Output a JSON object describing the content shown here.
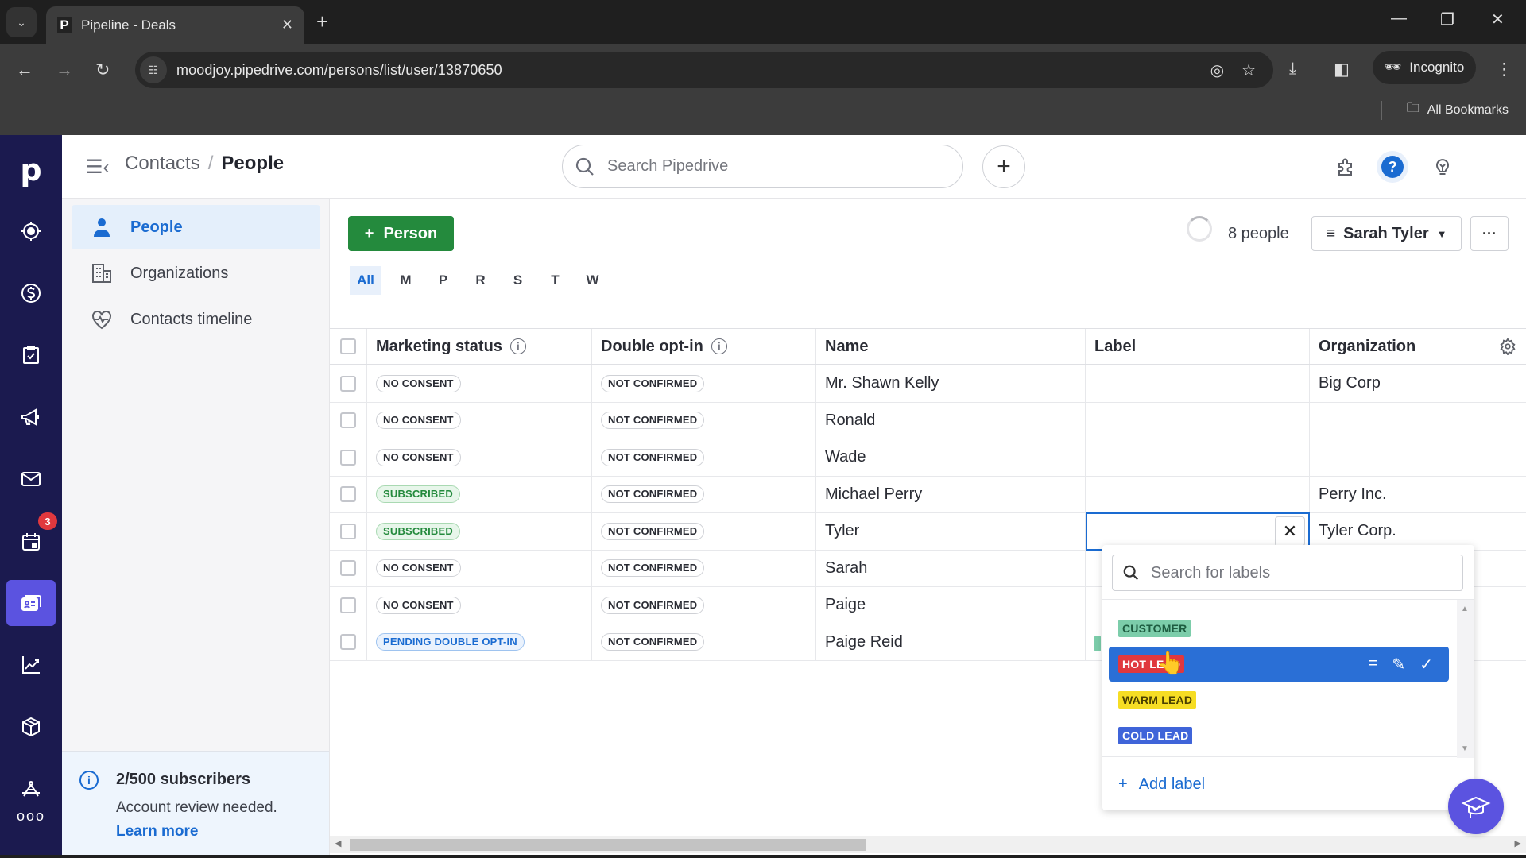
{
  "browser": {
    "tab_title": "Pipeline - Deals",
    "tab_favicon": "P",
    "url": "moodjoy.pipedrive.com/persons/list/user/13870650",
    "incognito_label": "Incognito",
    "bookmarks_label": "All Bookmarks"
  },
  "rail": {
    "logo": "p",
    "items": [
      {
        "icon": "target-icon",
        "label": "Leads"
      },
      {
        "icon": "dollar-icon",
        "label": "Deals"
      },
      {
        "icon": "clipboard-check-icon",
        "label": "Projects"
      },
      {
        "icon": "megaphone-icon",
        "label": "Campaigns"
      },
      {
        "icon": "mail-icon",
        "label": "Mail"
      },
      {
        "icon": "calendar-icon",
        "label": "Activities",
        "badge": "3"
      },
      {
        "icon": "contacts-card-icon",
        "label": "Contacts",
        "active": true
      },
      {
        "icon": "chart-icon",
        "label": "Insights"
      },
      {
        "icon": "box-icon",
        "label": "Products"
      },
      {
        "icon": "marketplace-icon",
        "label": "Marketplace"
      },
      {
        "icon": "more-icon",
        "label": "More"
      }
    ]
  },
  "header": {
    "breadcrumb_parent": "Contacts",
    "breadcrumb_sep": "/",
    "breadcrumb_current": "People",
    "search_placeholder": "Search Pipedrive",
    "add_label": "+"
  },
  "subnav": {
    "items": [
      {
        "label": "People",
        "icon": "person-icon",
        "active": true
      },
      {
        "label": "Organizations",
        "icon": "building-icon"
      },
      {
        "label": "Contacts timeline",
        "icon": "heart-pulse-icon"
      }
    ],
    "footer": {
      "title": "2/500 subscribers",
      "desc": "Account review needed.",
      "link": "Learn more"
    }
  },
  "toolbar": {
    "add_person_label": "Person",
    "count_label": "8 people",
    "filter_label": "Sarah Tyler",
    "more_label": "···",
    "alphabet": [
      "All",
      "M",
      "P",
      "R",
      "S",
      "T",
      "W"
    ],
    "alphabet_active": "All"
  },
  "table": {
    "columns": [
      "Marketing status",
      "Double opt-in",
      "Name",
      "Label",
      "Organization"
    ],
    "rows": [
      {
        "marketing": "NO CONSENT",
        "marketing_style": "neutral",
        "double_opt_in": "NOT CONFIRMED",
        "name": "Mr. Shawn Kelly",
        "label": "",
        "organization": "Big Corp"
      },
      {
        "marketing": "NO CONSENT",
        "marketing_style": "neutral",
        "double_opt_in": "NOT CONFIRMED",
        "name": "Ronald",
        "label": "",
        "organization": ""
      },
      {
        "marketing": "NO CONSENT",
        "marketing_style": "neutral",
        "double_opt_in": "NOT CONFIRMED",
        "name": "Wade",
        "label": "",
        "organization": ""
      },
      {
        "marketing": "SUBSCRIBED",
        "marketing_style": "green",
        "double_opt_in": "NOT CONFIRMED",
        "name": "Michael Perry",
        "label": "",
        "organization": "Perry Inc."
      },
      {
        "marketing": "SUBSCRIBED",
        "marketing_style": "green",
        "double_opt_in": "NOT CONFIRMED",
        "name": "Tyler",
        "label": "",
        "organization": "Tyler Corp.",
        "editing": true
      },
      {
        "marketing": "NO CONSENT",
        "marketing_style": "neutral",
        "double_opt_in": "NOT CONFIRMED",
        "name": "Sarah",
        "label": "",
        "organization": ""
      },
      {
        "marketing": "NO CONSENT",
        "marketing_style": "neutral",
        "double_opt_in": "NOT CONFIRMED",
        "name": "Paige",
        "label": "",
        "organization": ""
      },
      {
        "marketing": "PENDING DOUBLE OPT-IN",
        "marketing_style": "blue",
        "double_opt_in": "NOT CONFIRMED",
        "name": "Paige Reid",
        "label": "CUSTOMER",
        "organization": ""
      }
    ]
  },
  "label_dropdown": {
    "search_placeholder": "Search for labels",
    "options": [
      {
        "label": "CUSTOMER",
        "bg": "#7ccdaa",
        "fg": "#1d5c40"
      },
      {
        "label": "HOT LEAD",
        "bg": "#e0383e",
        "fg": "#ffffff",
        "highlighted": true
      },
      {
        "label": "WARM LEAD",
        "bg": "#f6dd24",
        "fg": "#4a3f00"
      },
      {
        "label": "COLD LEAD",
        "bg": "#3f64d9",
        "fg": "#ffffff"
      }
    ],
    "add_label": "Add label"
  },
  "colors": {
    "brand_dark": "#1b1a4f",
    "accent_blue": "#1a6bd1",
    "primary_green": "#248a3d",
    "active_rail": "#5b53e0"
  }
}
